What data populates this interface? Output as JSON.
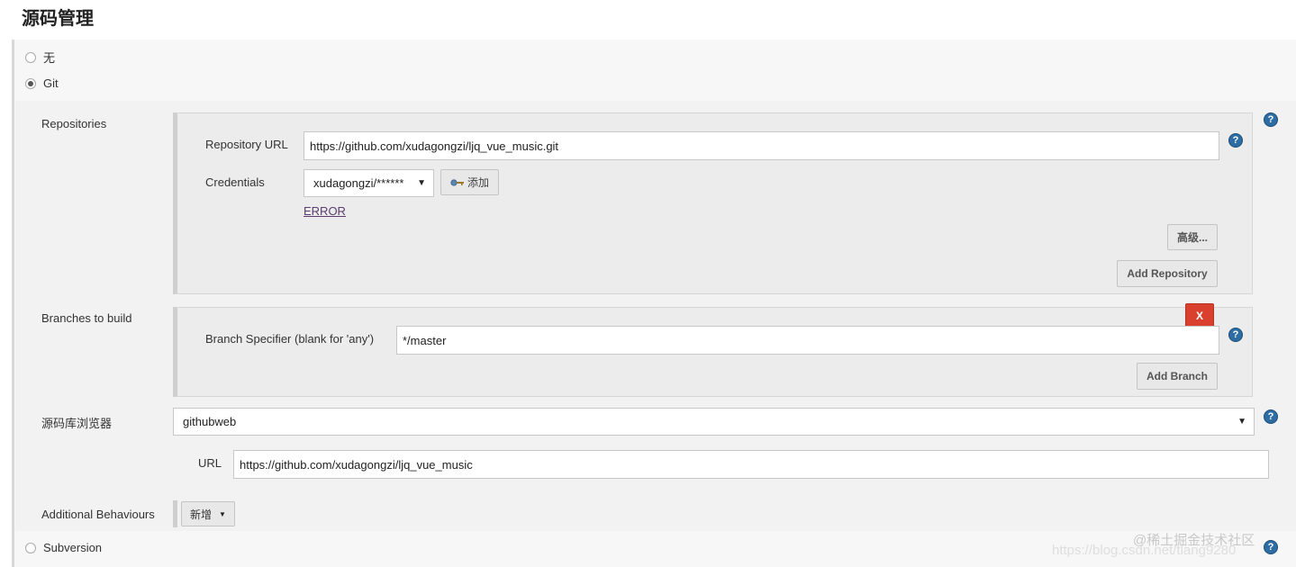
{
  "page": {
    "title": "源码管理"
  },
  "scm": {
    "option_none": "无",
    "option_git": "Git",
    "option_subversion": "Subversion"
  },
  "repositories": {
    "label": "Repositories",
    "url_label": "Repository URL",
    "url_value": "https://github.com/xudagongzi/ljq_vue_music.git",
    "credentials_label": "Credentials",
    "credentials_value": "xudagongzi/******",
    "add_credentials_label": "添加",
    "error_link": "ERROR",
    "advanced_button": "高级...",
    "add_repository_button": "Add Repository"
  },
  "branches": {
    "label": "Branches to build",
    "delete_button": "X",
    "specifier_label": "Branch Specifier (blank for 'any')",
    "specifier_value": "*/master",
    "add_branch_button": "Add Branch"
  },
  "browser": {
    "label": "源码库浏览器",
    "selected": "githubweb",
    "url_label": "URL",
    "url_value": "https://github.com/xudagongzi/ljq_vue_music"
  },
  "behaviours": {
    "label": "Additional Behaviours",
    "add_button": "新增"
  },
  "watermark": {
    "text1": "@稀土掘金技术社区",
    "text2": "https://blog.csdn.net/tlang9280"
  },
  "colors": {
    "help_icon": "#2d6da3",
    "delete_button": "#d9412e",
    "error_link": "#5a3c6e"
  },
  "icons": {
    "help": "?",
    "key": "key-icon",
    "dropdown": "▼"
  }
}
